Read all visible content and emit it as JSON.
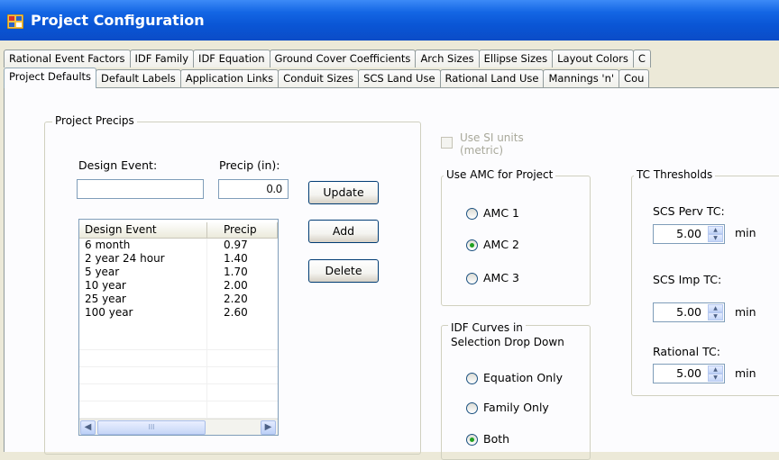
{
  "window": {
    "title": "Project Configuration"
  },
  "tabs": {
    "row1": [
      "Rational Event Factors",
      "IDF Family",
      "IDF Equation",
      "Ground Cover Coefficients",
      "Arch Sizes",
      "Ellipse Sizes",
      "Layout Colors",
      "C"
    ],
    "row2": [
      "Project Defaults",
      "Default Labels",
      "Application Links",
      "Conduit Sizes",
      "SCS Land Use",
      "Rational Land Use",
      "Mannings 'n'",
      "Cou"
    ],
    "active": "Project Defaults"
  },
  "project_precips": {
    "group_title": "Project Precips",
    "design_event_label": "Design Event:",
    "design_event_value": "",
    "precip_label": "Precip (in):",
    "precip_value": "0.0",
    "update_button": "Update",
    "add_button": "Add",
    "delete_button": "Delete",
    "columns": [
      "Design Event",
      "Precip"
    ],
    "rows": [
      {
        "event": "6 month",
        "precip": "0.97"
      },
      {
        "event": "2 year 24 hour",
        "precip": "1.40"
      },
      {
        "event": "5 year",
        "precip": "1.70"
      },
      {
        "event": "10 year",
        "precip": "2.00"
      },
      {
        "event": "25 year",
        "precip": "2.20"
      },
      {
        "event": "100 year",
        "precip": "2.60"
      }
    ],
    "scroll_thumb_glyph": "III",
    "scroll_left_glyph": "◀",
    "scroll_right_glyph": "▶"
  },
  "si_units": {
    "label_line1": "Use SI units",
    "label_line2": "(metric)",
    "checked": false,
    "enabled": false
  },
  "amc": {
    "group_title": "Use AMC for Project",
    "options": [
      "AMC 1",
      "AMC 2",
      "AMC 3"
    ],
    "selected": "AMC 2"
  },
  "idf_curves": {
    "title_line1": "IDF Curves in",
    "title_line2": "Selection Drop Down",
    "options": [
      "Equation Only",
      "Family Only",
      "Both"
    ],
    "selected": "Both"
  },
  "tc_thresholds": {
    "group_title": "TC Thresholds",
    "scs_perv": {
      "label": "SCS Perv TC:",
      "value": "5.00",
      "unit": "min"
    },
    "scs_imp": {
      "label": "SCS Imp TC:",
      "value": "5.00",
      "unit": "min"
    },
    "rational": {
      "label": "Rational TC:",
      "value": "5.00",
      "unit": "min"
    }
  },
  "colors": {
    "title_bar": "#0a56d6",
    "tab_border": "#919b9c",
    "input_border": "#7f9db9"
  }
}
